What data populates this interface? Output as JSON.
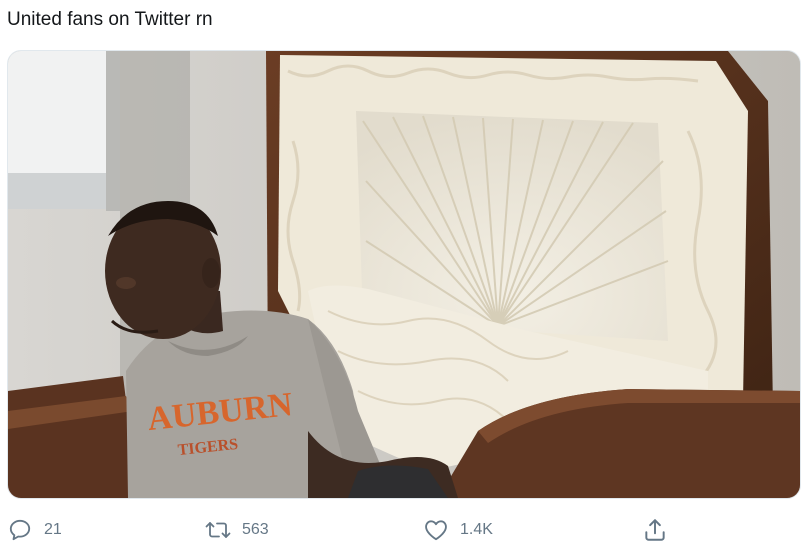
{
  "tweet": {
    "text": "United fans on Twitter rn"
  },
  "media": {
    "shirt_text_main": "AUBURN",
    "shirt_text_sub": "TIGERS"
  },
  "actions": {
    "reply": {
      "icon": "reply-icon",
      "count": "21"
    },
    "retweet": {
      "icon": "retweet-icon",
      "count": "563"
    },
    "like": {
      "icon": "heart-icon",
      "count": "1.4K"
    },
    "share": {
      "icon": "share-icon"
    }
  },
  "colors": {
    "text": "#14171a",
    "muted": "#657786",
    "border": "#e1e8ed"
  }
}
